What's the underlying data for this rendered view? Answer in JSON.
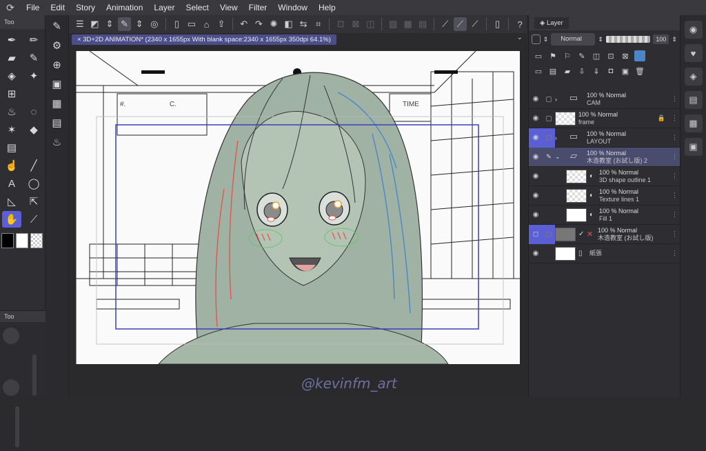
{
  "menubar": {
    "items": [
      "File",
      "Edit",
      "Story",
      "Animation",
      "Layer",
      "Select",
      "View",
      "Filter",
      "Window",
      "Help"
    ]
  },
  "document": {
    "title": "3D+2D ANIMATION* (2340 x 1655px With blank space:2340 x 1655px 350dpi 64.1%)"
  },
  "left_panel": {
    "tab": "Too",
    "bottom_tab": "Too"
  },
  "canvas": {
    "board_text_1": "#.",
    "board_text_2": "C.",
    "board_text_3": "TIME"
  },
  "watermark": "@kevinfm_art",
  "layer_panel": {
    "tab": "Layer",
    "blend_mode": "Normal",
    "opacity": "100",
    "layers": [
      {
        "opacity": "100 %",
        "mode": "Normal",
        "name": "CAM",
        "type": "folder",
        "selected": false
      },
      {
        "opacity": "100 %",
        "mode": "Normal",
        "name": "frame",
        "type": "raster",
        "selected": false
      },
      {
        "opacity": "100 %",
        "mode": "Normal",
        "name": "LAYOUT",
        "type": "folder",
        "selected": false
      },
      {
        "opacity": "100 %",
        "mode": "Normal",
        "name": "木造教室 (お試し版) 2",
        "type": "folder",
        "selected": true
      },
      {
        "opacity": "100 %",
        "mode": "Normal",
        "name": "3D shape outline 1",
        "type": "raster",
        "selected": false
      },
      {
        "opacity": "100 %",
        "mode": "Normal",
        "name": "Texture lines 1",
        "type": "raster",
        "selected": false
      },
      {
        "opacity": "100 %",
        "mode": "Normal",
        "name": "Fill 1",
        "type": "raster",
        "selected": false
      },
      {
        "opacity": "100 %",
        "mode": "Normal",
        "name": "木造教室 (お試し版)",
        "type": "3d",
        "selected": false
      },
      {
        "opacity": "",
        "mode": "",
        "name": "紙張",
        "type": "paper",
        "selected": false
      }
    ]
  },
  "colors": {
    "accent": "#5b5fd6",
    "selected_layer": "#4a4c6e"
  }
}
